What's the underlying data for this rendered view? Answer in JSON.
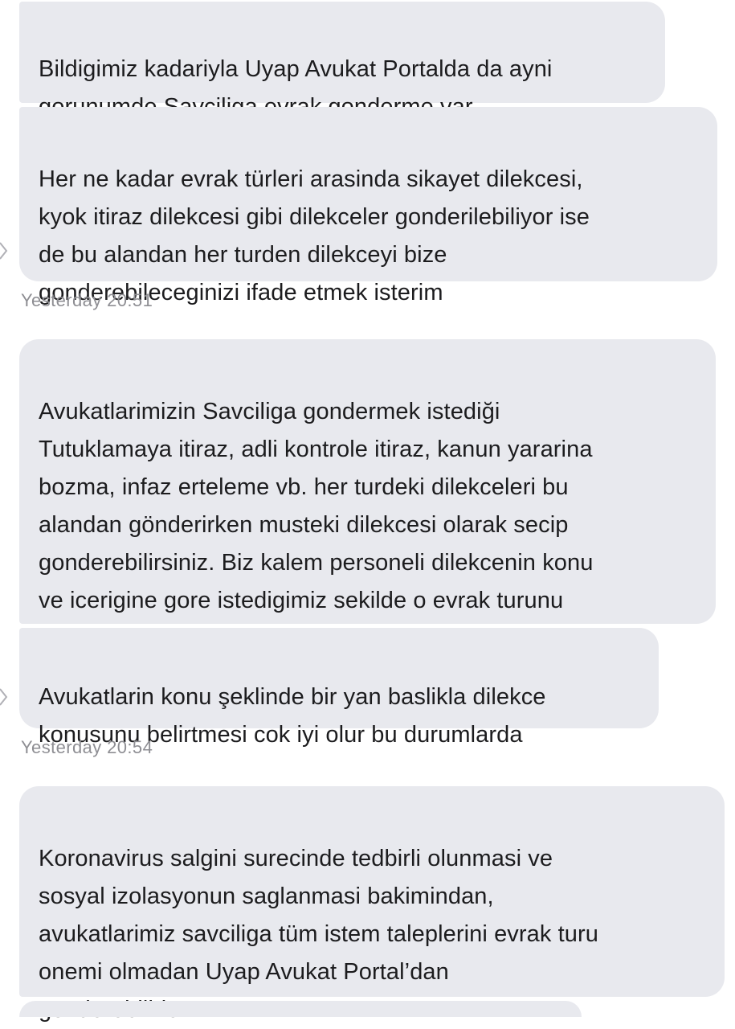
{
  "chat": {
    "groups": [
      {
        "messages": [
          {
            "text": "Bildigimiz kadariyla Uyap Avukat Portalda da ayni\ngorunumde Savciliga evrak gonderme var"
          },
          {
            "text": "Her ne kadar evrak türleri arasinda sikayet dilekcesi,\nkyok itiraz dilekcesi gibi dilekceler gonderilebiliyor ise\nde bu alandan her turden dilekceyi bize\ngonderebileceginizi ifade etmek isterim"
          }
        ],
        "timestamp": "Yesterday 20:51"
      },
      {
        "messages": [
          {
            "text": "Avukatlarimizin Savciliga gondermek istediği\nTutuklamaya itiraz, adli kontrole itiraz, kanun yararina\nbozma, infaz erteleme vb. her turdeki dilekceleri bu\nalandan gönderirken musteki dilekcesi olarak secip\ngonderebilirsiniz. Biz kalem personeli dilekcenin konu\nve icerigine gore istedigimiz sekilde o evrak turunu\ndegistirebiliyoruz..."
          },
          {
            "text": "Avukatlarin konu şeklinde bir yan baslikla dilekce\nkonusunu belirtmesi cok iyi olur bu durumlarda"
          }
        ],
        "timestamp": "Yesterday 20:54"
      },
      {
        "messages": [
          {
            "text": "Koronavirus salgini surecinde tedbirli olunmasi ve\nsosyal izolasyonun saglanmasi bakimindan,\navukatlarimiz savciliga tüm istem taleplerini evrak turu\nonemi olmadan Uyap Avukat Portal’dan\ngonderebilirler."
          }
        ]
      }
    ],
    "colors": {
      "bubble": "#e8e9ee",
      "text": "#1c1c1e",
      "timestamp": "#8e8e93"
    }
  }
}
